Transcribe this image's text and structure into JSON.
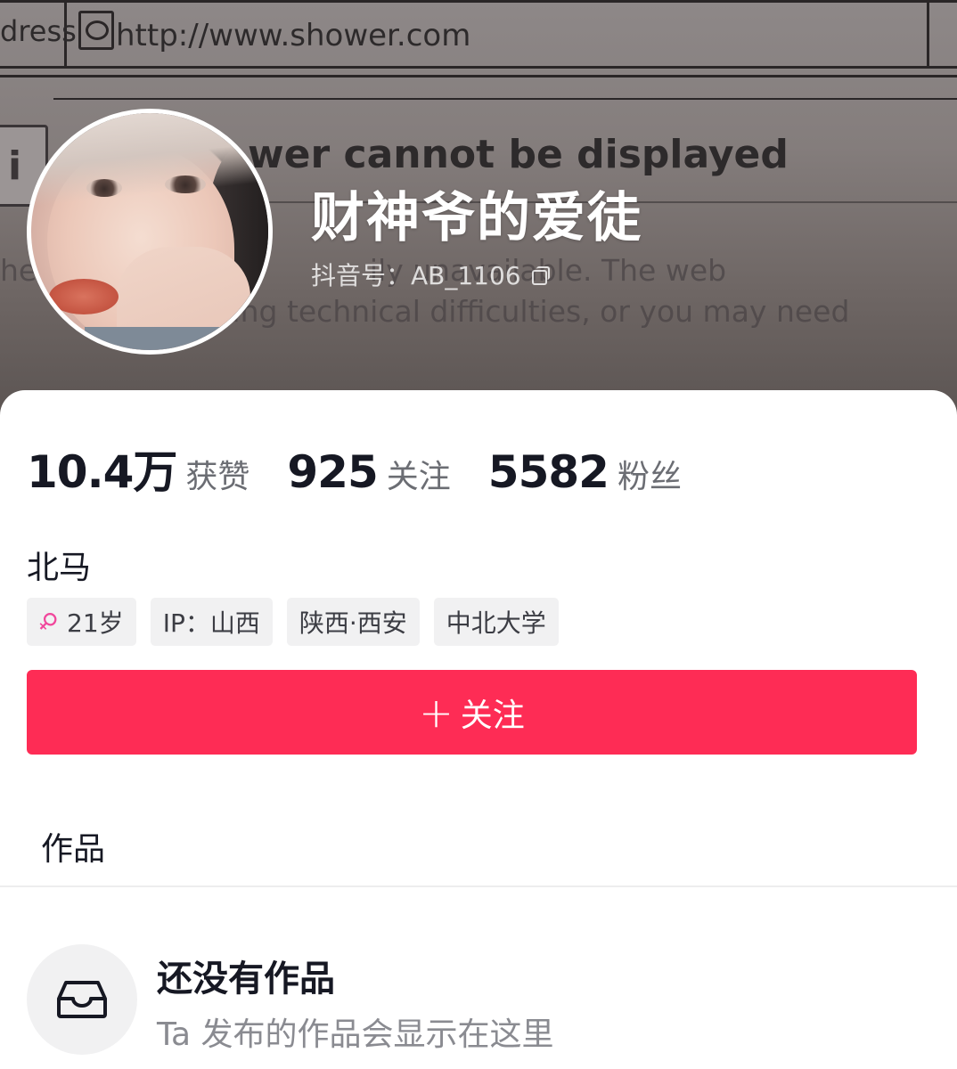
{
  "cover": {
    "address_fragment": "dress",
    "url": "http://www.shower.com",
    "info_glyph": "i",
    "heading_fragment": "wer cannot be displayed",
    "body_line1": "he            oki                   ily unavailable. The web",
    "body_line2": "                 riencing technical difficulties, or you may need"
  },
  "profile": {
    "nickname": "财神爷的爱徒",
    "account_label": "抖音号：AB_1106",
    "copy_icon": "copy-icon",
    "avatar_icon": "avatar"
  },
  "stats": [
    {
      "value": "10.4万",
      "label": "获赞"
    },
    {
      "value": "925",
      "label": "关注"
    },
    {
      "value": "5582",
      "label": "粉丝"
    }
  ],
  "bio": "北马",
  "tags": {
    "gender_icon": "female-icon",
    "age": "21岁",
    "ip": "IP：山西",
    "location": "陕西·西安",
    "school": "中北大学"
  },
  "follow_button": {
    "plus": "+",
    "label": "关注",
    "color": "#fe2c55"
  },
  "tabs": {
    "works": "作品"
  },
  "empty_state": {
    "icon": "inbox-icon",
    "title": "还没有作品",
    "subtitle": "Ta 发布的作品会显示在这里"
  }
}
